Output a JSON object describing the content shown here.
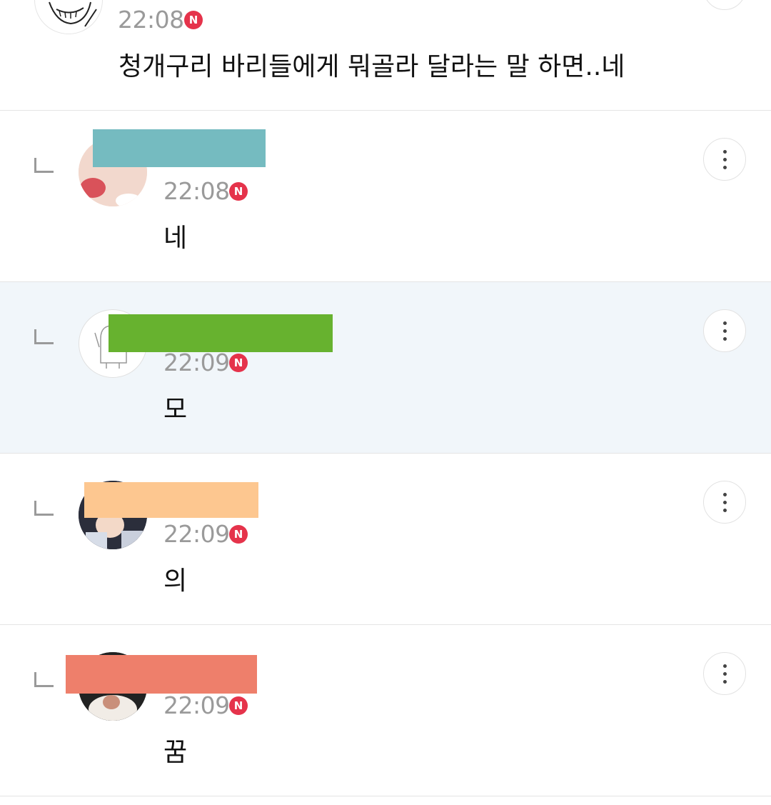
{
  "top_comment": {
    "time": "22:08",
    "badge": "N",
    "text": "청개구리 바리들에게 뭐골라 달라는 말 하면..네"
  },
  "replies": [
    {
      "time": "22:08",
      "badge": "N",
      "text": "네",
      "redact_color": "#75bbc0"
    },
    {
      "time": "22:09",
      "badge": "N",
      "text": "모",
      "redact_color": "#67b22f"
    },
    {
      "time": "22:09",
      "badge": "N",
      "text": "의",
      "redact_color": "#fdc790"
    },
    {
      "time": "22:09",
      "badge": "N",
      "text": "꿈",
      "redact_color": "#ee7f6b"
    }
  ],
  "colors": {
    "badge": "#e5334b",
    "highlight_row": "#f1f6fa",
    "divider": "#e4e4e4",
    "time_text": "#9a9a9a"
  },
  "icons": [
    "reply-arrow-icon",
    "more-vertical-icon",
    "new-badge-icon"
  ]
}
